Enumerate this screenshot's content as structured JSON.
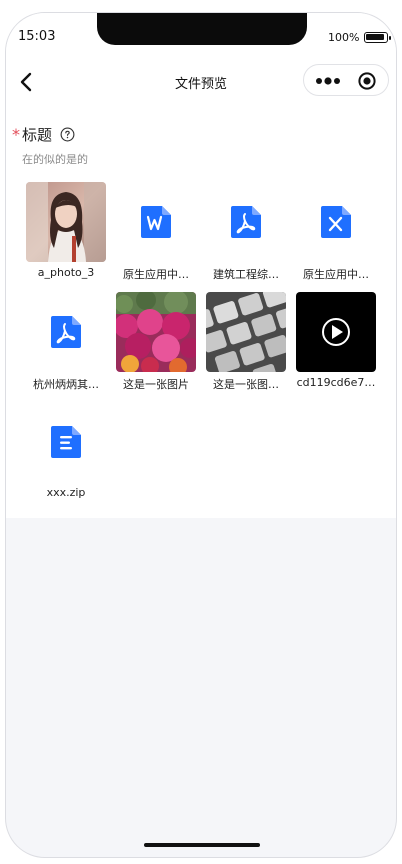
{
  "status_bar": {
    "time": "15:03",
    "battery": "100%"
  },
  "nav": {
    "title": "文件预览",
    "back_icon": "chevron-left-icon",
    "more_icon": "more-dots-icon",
    "close_icon": "target-close-icon"
  },
  "form": {
    "required_mark": "*",
    "title": "标题",
    "help_icon": "question-circle-icon",
    "description": "在的似的是的"
  },
  "files": [
    {
      "name": "a_photo_3",
      "kind": "photo-portrait"
    },
    {
      "name": "原生应用中…",
      "kind": "word",
      "icon": "word-file-icon"
    },
    {
      "name": "建筑工程综…",
      "kind": "pdf",
      "icon": "pdf-file-icon"
    },
    {
      "name": "原生应用中…",
      "kind": "excel",
      "icon": "excel-file-icon"
    },
    {
      "name": "杭州炳炳其…",
      "kind": "pdf",
      "icon": "pdf-file-icon"
    },
    {
      "name": "这是一张图片",
      "kind": "photo-flowers"
    },
    {
      "name": "这是一张图…",
      "kind": "photo-keyboard"
    },
    {
      "name": "cd119cd6e7…",
      "kind": "video",
      "icon": "play-circle-icon"
    },
    {
      "name": "xxx.zip",
      "kind": "zip",
      "icon": "zip-file-icon"
    }
  ],
  "colors": {
    "accent": "#1f6fff",
    "required": "#e34d59",
    "page_bg": "#f5f6f9"
  }
}
